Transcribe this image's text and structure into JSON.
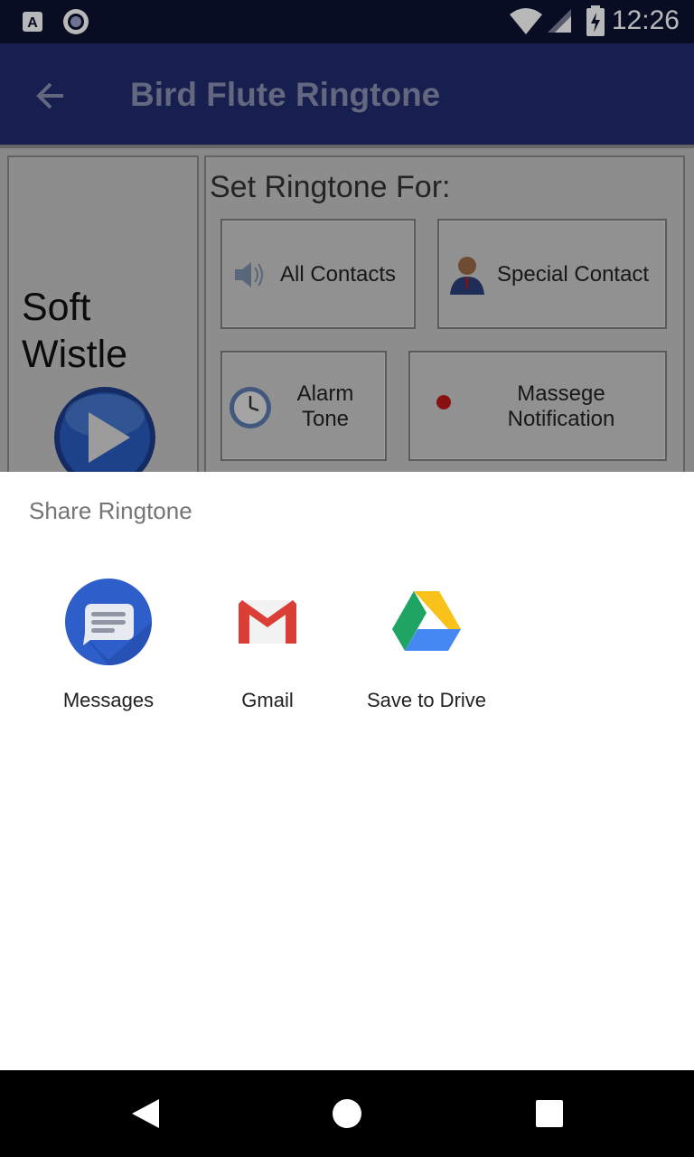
{
  "status_bar": {
    "time": "12:26",
    "icons": [
      "app-a-icon",
      "record-icon",
      "wifi-icon",
      "signal-icon",
      "battery-charging-icon"
    ]
  },
  "app_bar": {
    "back_icon": "arrow-back-icon",
    "title": "Bird Flute Ringtone"
  },
  "content": {
    "track": {
      "name_line1": "Soft",
      "name_line2": "Wistle",
      "play_icon": "play-button-icon"
    },
    "set_ringtone": {
      "heading": "Set Ringtone For:",
      "buttons": [
        {
          "label": "All Contacts",
          "icon": "speaker-icon"
        },
        {
          "label": "Special Contact",
          "icon": "person-icon"
        },
        {
          "label_line1": "Alarm",
          "label_line2": "Tone",
          "icon": "clock-icon"
        },
        {
          "label_line1": "Massege",
          "label_line2": "Notification",
          "icon": "notification-dot-icon"
        }
      ]
    }
  },
  "share_sheet": {
    "title": "Share Ringtone",
    "targets": [
      {
        "label": "Messages",
        "icon": "messages-icon"
      },
      {
        "label": "Gmail",
        "icon": "gmail-icon"
      },
      {
        "label": "Save to Drive",
        "icon": "drive-icon"
      }
    ]
  },
  "nav_bar": {
    "buttons": [
      "back-triangle-icon",
      "home-circle-icon",
      "recents-square-icon"
    ]
  },
  "colors": {
    "status_bar": "#0d1233",
    "app_bar": "#1f2b6b",
    "sheet_background": "#ffffff"
  }
}
